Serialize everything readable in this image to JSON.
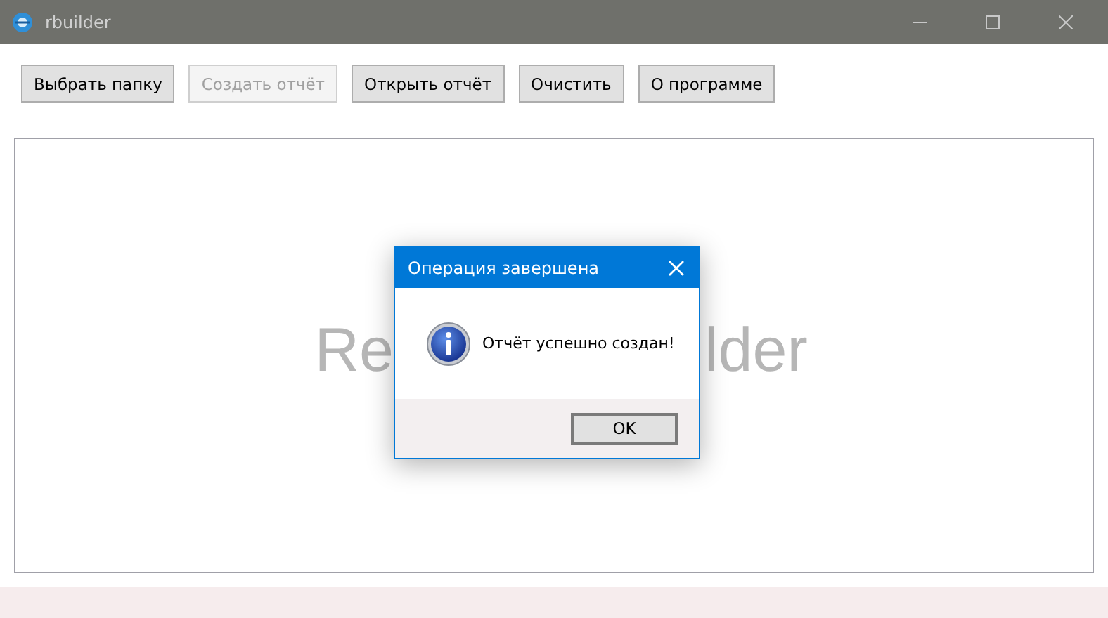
{
  "window": {
    "title": "rbuilder"
  },
  "toolbar": [
    {
      "label": "Выбрать папку",
      "disabled": false
    },
    {
      "label": "Создать отчёт",
      "disabled": true
    },
    {
      "label": "Открыть отчёт",
      "disabled": false
    },
    {
      "label": "Очистить",
      "disabled": false
    },
    {
      "label": "О программе",
      "disabled": false
    }
  ],
  "panel": {
    "watermark_visible_parts": [
      "Re",
      "lder"
    ]
  },
  "dialog": {
    "title": "Операция завершена",
    "message": "Отчёт успешно создан!",
    "button": "OK"
  }
}
